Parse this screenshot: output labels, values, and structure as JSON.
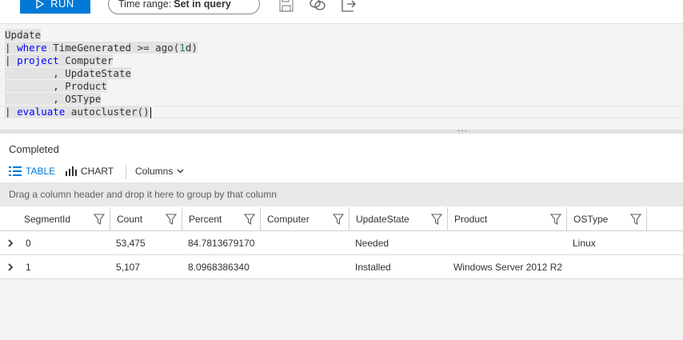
{
  "toolbar": {
    "run_label": "RUN",
    "time_range_label": "Time range:",
    "time_range_value": "Set in query"
  },
  "editor": {
    "lines": [
      {
        "segments": [
          {
            "text": "Update",
            "cls": "plain"
          }
        ]
      },
      {
        "segments": [
          {
            "text": "| ",
            "cls": "plain"
          },
          {
            "text": "where",
            "cls": "kw"
          },
          {
            "text": " TimeGenerated >= ago(",
            "cls": "plain"
          },
          {
            "text": "1",
            "cls": "num"
          },
          {
            "text": "d)",
            "cls": "plain"
          }
        ]
      },
      {
        "segments": [
          {
            "text": "| ",
            "cls": "plain"
          },
          {
            "text": "project",
            "cls": "kw"
          },
          {
            "text": " Computer",
            "cls": "plain"
          }
        ]
      },
      {
        "segments": [
          {
            "text": "        , UpdateState",
            "cls": "plain"
          }
        ]
      },
      {
        "segments": [
          {
            "text": "        , Product",
            "cls": "plain"
          }
        ]
      },
      {
        "segments": [
          {
            "text": "        , OSType",
            "cls": "plain"
          }
        ]
      },
      {
        "segments": [
          {
            "text": "| ",
            "cls": "plain"
          },
          {
            "text": "evaluate",
            "cls": "kw"
          },
          {
            "text": " autocluster()",
            "cls": "plain"
          }
        ]
      }
    ],
    "splitter_dots": "..."
  },
  "results": {
    "status": "Completed",
    "tab_table": "TABLE",
    "tab_chart": "CHART",
    "columns_label": "Columns",
    "group_hint": "Drag a column header and drop it here to group by that column",
    "columns": [
      "SegmentId",
      "Count",
      "Percent",
      "Computer",
      "UpdateState",
      "Product",
      "OSType"
    ],
    "rows": [
      [
        "0",
        "53,475",
        "84.7813679170",
        "",
        "Needed",
        "",
        "Linux"
      ],
      [
        "1",
        "5,107",
        "8.0968386340",
        "",
        "Installed",
        "Windows Server 2012 R2",
        ""
      ]
    ]
  },
  "colors": {
    "accent": "#0078d4",
    "keyword": "#0000ff",
    "number": "#098658"
  }
}
